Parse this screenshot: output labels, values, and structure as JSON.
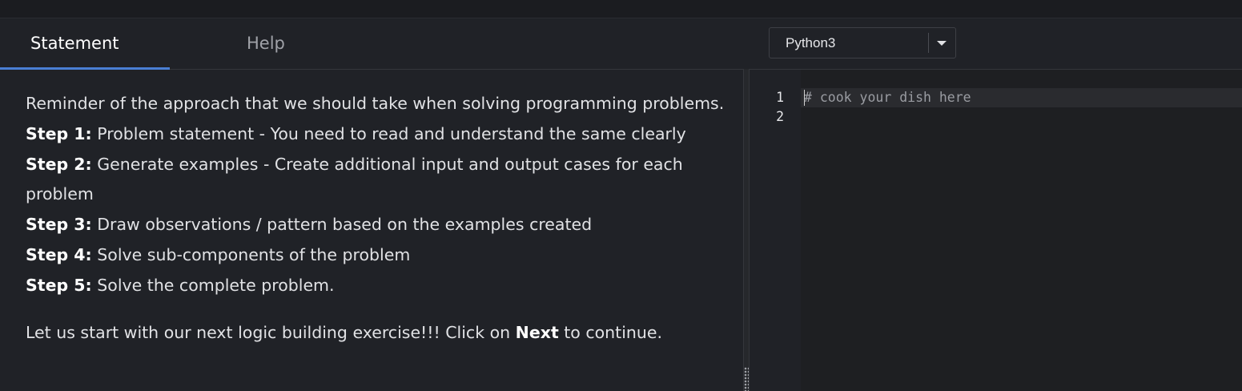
{
  "tabs": {
    "statement": "Statement",
    "help": "Help"
  },
  "statement": {
    "intro": "Reminder of the approach that we should take when solving programming problems.",
    "steps": [
      {
        "label": "Step 1:",
        "text": " Problem statement - You need to read and understand the same clearly"
      },
      {
        "label": "Step 2:",
        "text": " Generate examples - Create additional input and output cases for each problem"
      },
      {
        "label": "Step 3:",
        "text": " Draw observations / pattern based on the examples created"
      },
      {
        "label": "Step 4:",
        "text": " Solve sub-components of the problem"
      },
      {
        "label": "Step 5:",
        "text": " Solve the complete problem."
      }
    ],
    "closing_before": "Let us start with our next logic building exercise!!! Click on ",
    "closing_bold": "Next",
    "closing_after": " to continue."
  },
  "editor": {
    "language": "Python3",
    "line_numbers": [
      "1",
      "2"
    ],
    "lines": [
      "# cook your dish here",
      ""
    ]
  },
  "colors": {
    "accent": "#4a7fd4",
    "background": "#202227",
    "editor_background": "#1e1f22"
  }
}
